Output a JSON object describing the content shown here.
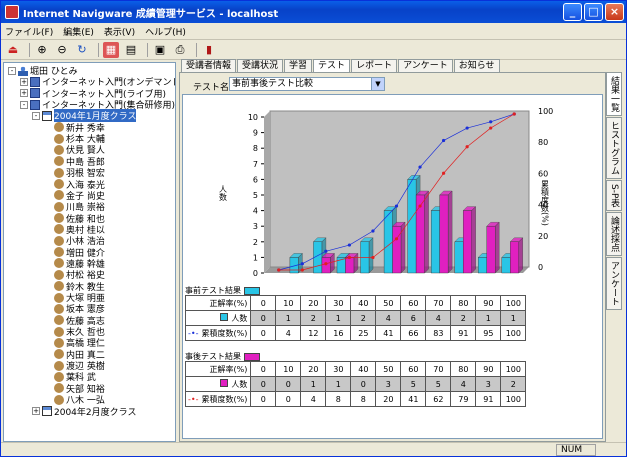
{
  "window": {
    "title": "Internet Navigware 成績管理サービス - localhost",
    "min": "_",
    "max": "□",
    "close": "×"
  },
  "menu": [
    "ファイル(F)",
    "編集(E)",
    "表示(V)",
    "ヘルプ(H)"
  ],
  "tree": {
    "root": "堀田 ひとみ",
    "courses": [
      "インターネット入門(オンデマンド用)",
      "インターネット入門(ライブ用)",
      "インターネット入門(集合研修用)"
    ],
    "selected_class": "2004年1月度クラス",
    "students": [
      "新井 秀幸",
      "杉本 大輔",
      "伏見 賢人",
      "中島 吾郎",
      "羽根 智宏",
      "入海 泰光",
      "金子 尚史",
      "川島 崇裕",
      "佐藤 和也",
      "奥村 桂以",
      "小林 浩治",
      "増田 健介",
      "遠藤 幹雄",
      "村松 裕史",
      "鈴木 教生",
      "大塚 明亜",
      "坂本 憲彦",
      "佐藤 高志",
      "末久 哲也",
      "高橋 理仁",
      "内田 真二",
      "渡辺 英樹",
      "葉科 武",
      "矢部 知裕",
      "八木 一弘"
    ],
    "other_class": "2004年2月度クラス"
  },
  "tabs": [
    "受講者情報",
    "受講状況",
    "学習",
    "テスト",
    "レポート",
    "アンケート",
    "お知らせ"
  ],
  "active_tab": "テスト",
  "test": {
    "label": "テスト名:",
    "value": "事前事後テスト比較"
  },
  "vtabs": [
    "結果一覧",
    "ヒストグラム",
    "S-P表",
    "論述採点",
    "アンケート"
  ],
  "status": {
    "num": "NUM"
  },
  "colors": {
    "pre": "#29c5e6",
    "post": "#e020c0",
    "cum_pre": "#1a2fd8",
    "cum_post": "#e02020"
  },
  "chart_data": {
    "type": "bar",
    "categories": [
      "0",
      "10",
      "20",
      "30",
      "40",
      "50",
      "60",
      "70",
      "80",
      "90",
      "100"
    ],
    "series": [
      {
        "name": "事前テスト結果 人数",
        "values": [
          0,
          1,
          2,
          1,
          2,
          4,
          6,
          4,
          2,
          1,
          1
        ]
      },
      {
        "name": "事後テスト結果 人数",
        "values": [
          0,
          0,
          1,
          1,
          0,
          3,
          5,
          5,
          4,
          3,
          2
        ]
      },
      {
        "name": "事前テスト結果 累積度数(%)",
        "values": [
          0,
          4,
          12,
          16,
          25,
          41,
          66,
          83,
          91,
          95,
          100
        ]
      },
      {
        "name": "事後テスト結果 累積度数(%)",
        "values": [
          0,
          0,
          4,
          8,
          8,
          20,
          41,
          62,
          79,
          91,
          100
        ]
      }
    ],
    "ylabel": "人数",
    "y2label": "累積度数(%)",
    "ylim": [
      0,
      10
    ],
    "y2lim": [
      0,
      100
    ],
    "yticks": [
      "0",
      "1",
      "2",
      "3",
      "4",
      "5",
      "6",
      "7",
      "8",
      "9",
      "10"
    ],
    "y2ticks": [
      "0",
      "20",
      "40",
      "60",
      "80",
      "100"
    ]
  },
  "pre": {
    "title": "事前テスト結果",
    "row1": "正解率(%)",
    "row2": "人数",
    "row3": "累積度数(%)"
  },
  "post": {
    "title": "事後テスト結果",
    "row1": "正解率(%)",
    "row2": "人数",
    "row3": "累積度数(%)"
  }
}
